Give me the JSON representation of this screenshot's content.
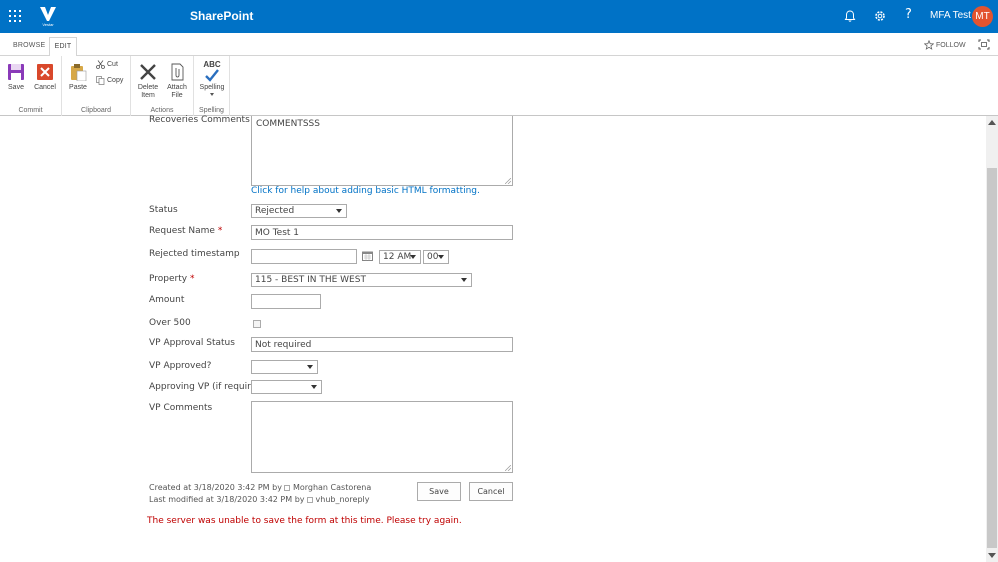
{
  "suitebar": {
    "brand": "SharePoint",
    "logo_caption": "Vestar",
    "username": "MFA Test",
    "avatar_initials": "MT",
    "help_glyph": "?",
    "bg_color": "#0072c6"
  },
  "tabs": {
    "browse": "BROWSE",
    "edit": "EDIT",
    "follow": "FOLLOW"
  },
  "ribbon": {
    "commit": {
      "label": "Commit",
      "save": "Save",
      "cancel": "Cancel"
    },
    "clipboard": {
      "label": "Clipboard",
      "paste": "Paste",
      "cut": "Cut",
      "copy": "Copy"
    },
    "actions": {
      "label": "Actions",
      "delete_line1": "Delete",
      "delete_line2": "Item",
      "attach_line1": "Attach",
      "attach_line2": "File"
    },
    "spelling": {
      "label": "Spelling",
      "button": "Spelling",
      "abc": "ABC"
    }
  },
  "form": {
    "recoveries_comments": {
      "label": "Recoveries Comments",
      "value": "COMMENTSSS"
    },
    "html_help_link": "Click for help about adding basic HTML formatting.",
    "status": {
      "label": "Status",
      "value": "Rejected"
    },
    "request_name": {
      "label": "Request Name",
      "required_mark": "*",
      "value": "MO Test 1"
    },
    "rejected_timestamp": {
      "label": "Rejected timestamp",
      "date_value": "",
      "hour": "12 AM",
      "minute": "00"
    },
    "property": {
      "label": "Property",
      "required_mark": "*",
      "value": "115 - BEST IN THE WEST"
    },
    "amount": {
      "label": "Amount",
      "value": ""
    },
    "over_500": {
      "label": "Over 500"
    },
    "vp_approval_status": {
      "label": "VP Approval Status",
      "value": "Not required"
    },
    "vp_approved": {
      "label": "VP Approved?",
      "value": ""
    },
    "approving_vp": {
      "label": "Approving VP (if required)",
      "value": ""
    },
    "vp_comments": {
      "label": "VP Comments",
      "value": ""
    }
  },
  "meta": {
    "created_prefix": "Created at 3/18/2020 3:42 PM  by",
    "created_by": "Morghan Castorena",
    "modified_prefix": "Last modified at 3/18/2020 3:42 PM  by",
    "modified_by": "vhub_noreply"
  },
  "buttons": {
    "save": "Save",
    "cancel": "Cancel"
  },
  "error_message": "The server was unable to save the form at this time. Please try again.",
  "colors": {
    "accent": "#0072c6",
    "error": "#bf0000",
    "avatar": "#e3542f"
  }
}
